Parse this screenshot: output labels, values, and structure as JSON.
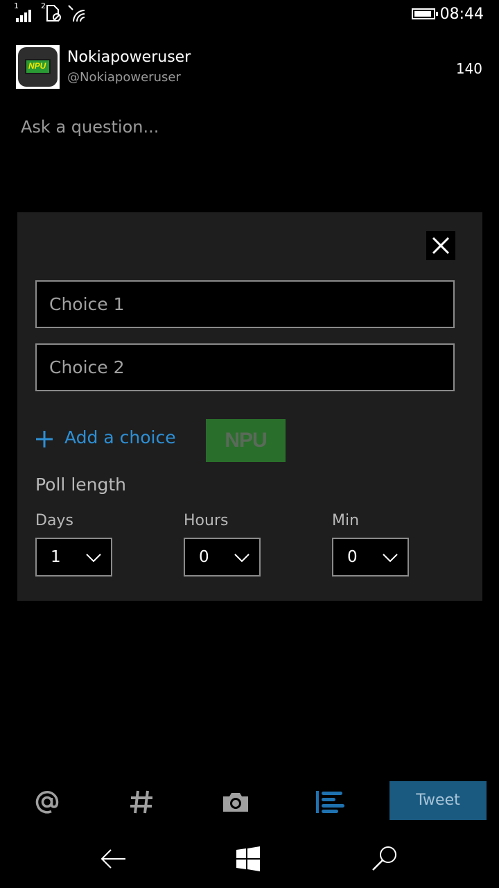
{
  "status_bar": {
    "sim1_label": "1",
    "sim2_label": "2",
    "time": "08:44"
  },
  "account": {
    "avatar_text": "NPU",
    "display_name": "Nokiapoweruser",
    "handle": "@Nokiapoweruser",
    "char_count": "140"
  },
  "compose": {
    "placeholder": "Ask a question..."
  },
  "poll": {
    "choice1_placeholder": "Choice 1",
    "choice2_placeholder": "Choice 2",
    "add_choice_label": "Add a choice",
    "watermark_text": "NPU",
    "poll_length_label": "Poll length",
    "days_label": "Days",
    "days_value": "1",
    "hours_label": "Hours",
    "hours_value": "0",
    "min_label": "Min",
    "min_value": "0"
  },
  "app_bar": {
    "icons": [
      "at-icon",
      "hashtag-icon",
      "camera-icon",
      "poll-icon"
    ],
    "tweet_label": "Tweet"
  },
  "nav_bar": {
    "icons": [
      "back-icon",
      "windows-icon",
      "search-icon"
    ]
  },
  "colors": {
    "accent": "#2d8fd5",
    "tweet_button_bg": "#1a5a80",
    "panel_bg": "#1e1e1e",
    "background": "#000000"
  }
}
